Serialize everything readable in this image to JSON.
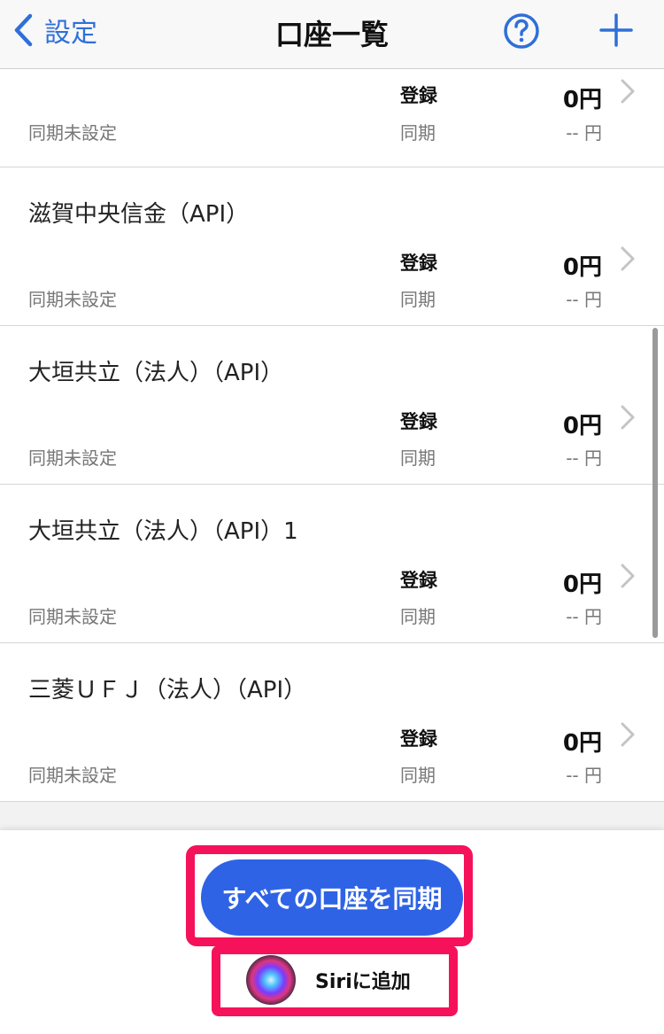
{
  "navbar": {
    "back_label": "設定",
    "title": "口座一覧"
  },
  "colors": {
    "accent": "#2f6fd8",
    "sync_button": "#2e63e6",
    "highlight": "#f5125a"
  },
  "icons": [
    "chevron-left-icon",
    "help-circle-icon",
    "plus-icon",
    "chevron-right-icon",
    "siri-icon"
  ],
  "accounts": [
    {
      "name": "",
      "sync_status": "同期未設定",
      "reg_label": "登録",
      "sync_label": "同期",
      "amount": "0円",
      "amount_sync": "-- 円"
    },
    {
      "name": "滋賀中央信金（API）",
      "sync_status": "同期未設定",
      "reg_label": "登録",
      "sync_label": "同期",
      "amount": "0円",
      "amount_sync": "-- 円"
    },
    {
      "name": "大垣共立（法人）（API）",
      "sync_status": "同期未設定",
      "reg_label": "登録",
      "sync_label": "同期",
      "amount": "0円",
      "amount_sync": "-- 円"
    },
    {
      "name": "大垣共立（法人）（API）1",
      "sync_status": "同期未設定",
      "reg_label": "登録",
      "sync_label": "同期",
      "amount": "0円",
      "amount_sync": "-- 円"
    },
    {
      "name": "三菱ＵＦＪ（法人）（API）",
      "sync_status": "同期未設定",
      "reg_label": "登録",
      "sync_label": "同期",
      "amount": "0円",
      "amount_sync": "-- 円"
    }
  ],
  "bottom": {
    "sync_all_label": "すべての口座を同期",
    "siri_label": "Siriに追加"
  }
}
